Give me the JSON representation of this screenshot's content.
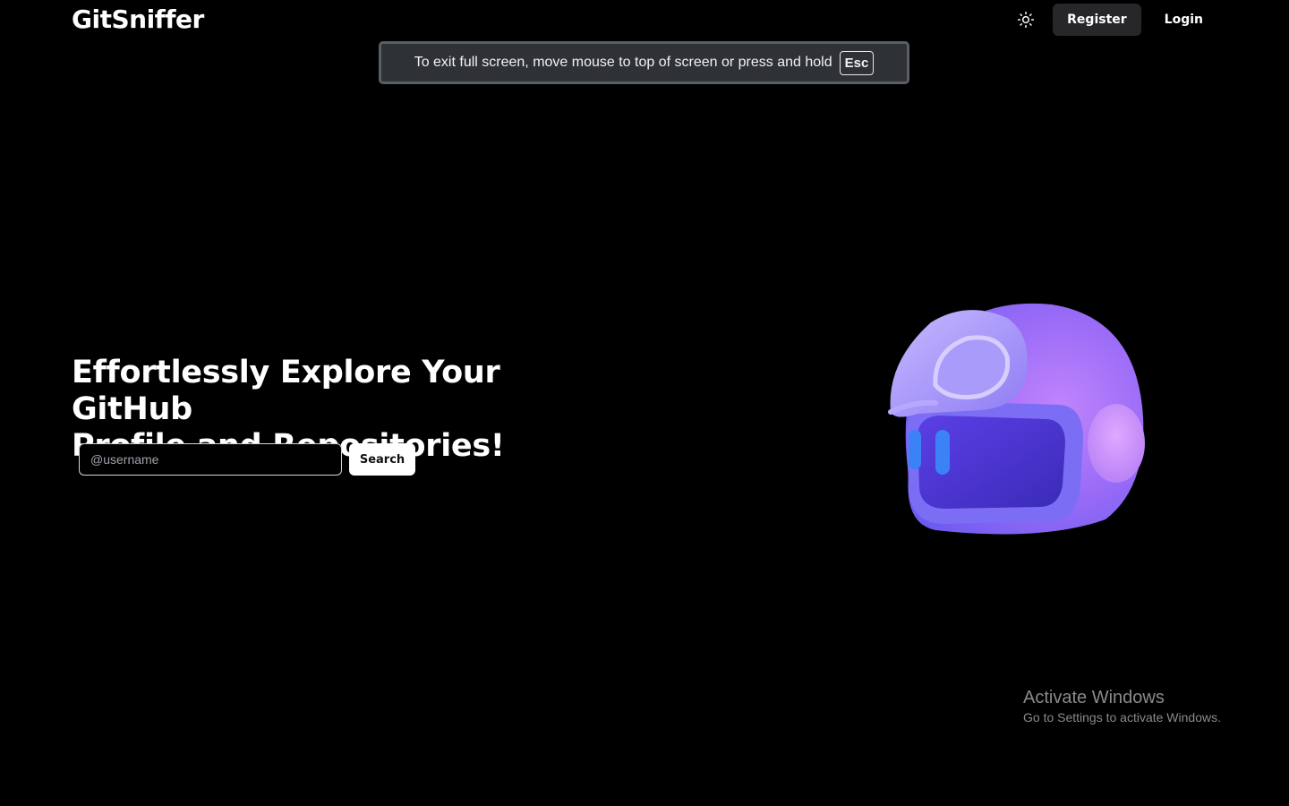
{
  "app": {
    "logo": "GitSniffer"
  },
  "nav": {
    "theme_icon": "sun-icon",
    "register_label": "Register",
    "login_label": "Login"
  },
  "fullscreen_notice": {
    "message": "To exit full screen, move mouse to top of screen or press and hold",
    "key": "Esc"
  },
  "hero": {
    "title_line1": "Effortlessly Explore Your GitHub",
    "title_line2": "Profile and Repositories!",
    "search_placeholder": "@username",
    "search_button": "Search"
  },
  "illustration": {
    "name": "helmet-robot-mascot",
    "color": "#8b5cf6"
  },
  "watermark": {
    "title": "Activate Windows",
    "subtitle": "Go to Settings to activate Windows."
  }
}
